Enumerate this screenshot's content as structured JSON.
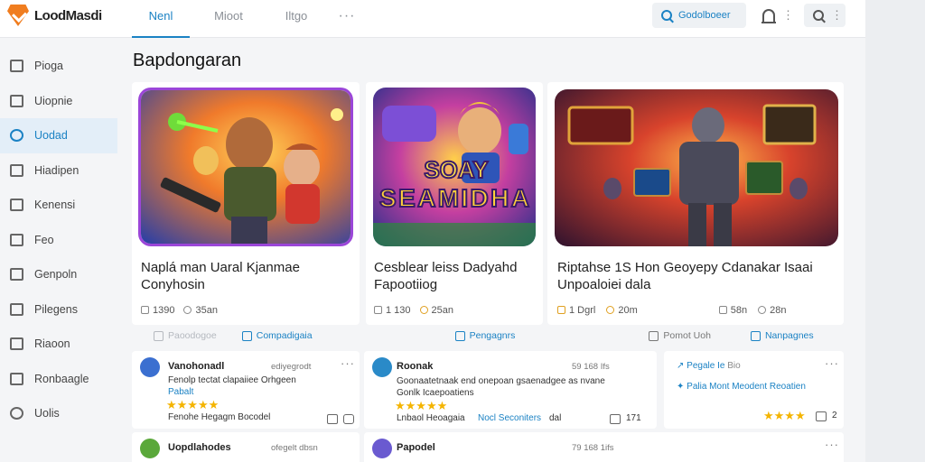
{
  "app": {
    "logo_text": "LoodMasdi"
  },
  "tabs": [
    {
      "label": "Nenl"
    },
    {
      "label": "Mioot"
    },
    {
      "label": "Iltgo"
    },
    {
      "label": "···"
    }
  ],
  "search": {
    "label": "Godolboeer"
  },
  "page_title": "Bapdongaran",
  "sidebar": {
    "items": [
      {
        "label": "Pioga",
        "icon": "home-icon"
      },
      {
        "label": "Uiopnie",
        "icon": "book-icon"
      },
      {
        "label": "Uodad",
        "icon": "search-icon"
      },
      {
        "label": "Hiadipen",
        "icon": "folder-icon"
      },
      {
        "label": "Kenensi",
        "icon": "card-icon"
      },
      {
        "label": "Feo",
        "icon": "trend-icon"
      },
      {
        "label": "Genpoln",
        "icon": "puzzle-icon"
      },
      {
        "label": "Pilegens",
        "icon": "list-icon"
      },
      {
        "label": "Riaoon",
        "icon": "chart-icon"
      },
      {
        "label": "Ronbaagle",
        "icon": "mail-icon"
      },
      {
        "label": "Uolis",
        "icon": "check-icon"
      }
    ]
  },
  "cards": [
    {
      "title_line1": "Naplá man Uaral Kjanmae",
      "title_line2": "Conyhosin",
      "meta": [
        "1390",
        "35an"
      ]
    },
    {
      "title_line1": "Cesblear leiss Dadyahd",
      "title_line2": "Fapootiiog",
      "meta": [
        "1 130",
        "25an"
      ],
      "art_text_1": "SOAY",
      "art_text_2": "SEAMIDHA"
    },
    {
      "title_line1": "Riptahse 1S Hon Geoyepy Cdanakar Isaai",
      "title_line2": "Unpoaloiei dala",
      "meta": [
        "1 Dgrl",
        "20m",
        "58n",
        "28n"
      ]
    }
  ],
  "chips": [
    {
      "label": "Paoodogoe"
    },
    {
      "label": "Compadigaia"
    },
    {
      "label": "Pengagnrs"
    },
    {
      "label": "Pomot Uoh"
    },
    {
      "label": "Nanpagnes"
    }
  ],
  "reviews": [
    {
      "name": "Vanohonadl",
      "time": "ediyegrodt",
      "line1": "Fenolp tectat clapaiiee Orhgeen",
      "line2": "Pabalt",
      "line3": "Fenohe Hegagm Bocodel"
    },
    {
      "name": "Roonak",
      "time": "59 168 Ifs",
      "line1": "Goonaatetnaak end onepoan gsaenadgee as nvane",
      "line2": "Gonlk Icaepoatiens",
      "line3": "Lnbaol Heoagaia",
      "line3b": "Nocl Seconiters",
      "line3c": "dal",
      "count": "171"
    },
    {
      "line1": "Pegale Ie",
      "line1b": "Bio",
      "line2": "Palia Mont Meodent Reoatien",
      "count": "2"
    },
    {
      "name": "Uopdlahodes",
      "time": "ofegelt dbsn"
    },
    {
      "name": "Papodel",
      "time": "79 168 1ifs"
    }
  ],
  "colors": {
    "accent": "#1b82c4",
    "brand": "#f07d1f",
    "stars": "#f4b400"
  }
}
